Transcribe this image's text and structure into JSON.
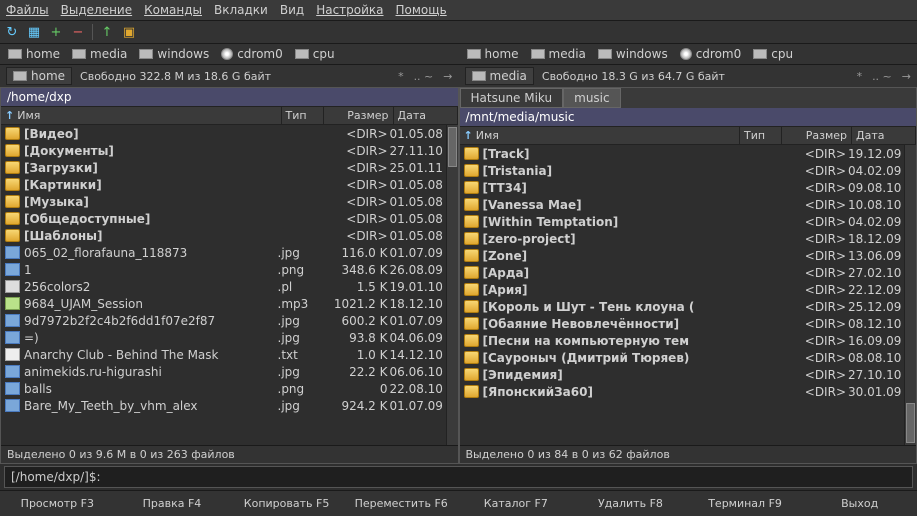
{
  "menu": [
    "Файлы",
    "Выделение",
    "Команды",
    "Вкладки",
    "Вид",
    "Настройка",
    "Помощь"
  ],
  "toolbar_icons": [
    "↻",
    "▦",
    "+",
    "−",
    "",
    "↑",
    "▣"
  ],
  "drives": [
    "home",
    "media",
    "windows",
    "cdrom0",
    "cpu"
  ],
  "left": {
    "current_drive": "home",
    "free": "Свободно 322.8 M из 18.6 G байт",
    "hdr_btns": [
      "*",
      ".. ~",
      "→"
    ],
    "path": "/home/dxp",
    "cols": {
      "name": "Имя",
      "ext": "Тип",
      "size": "Размер",
      "date": "Дата"
    },
    "files": [
      {
        "icon": "folder",
        "name": "[Видео]",
        "ext": "",
        "size": "<DIR>",
        "date": "01.05.08",
        "bold": true
      },
      {
        "icon": "folder",
        "name": "[Документы]",
        "ext": "",
        "size": "<DIR>",
        "date": "27.11.10",
        "bold": true
      },
      {
        "icon": "folder",
        "name": "[Загрузки]",
        "ext": "",
        "size": "<DIR>",
        "date": "25.01.11",
        "bold": true
      },
      {
        "icon": "folder",
        "name": "[Картинки]",
        "ext": "",
        "size": "<DIR>",
        "date": "01.05.08",
        "bold": true
      },
      {
        "icon": "folder",
        "name": "[Музыка]",
        "ext": "",
        "size": "<DIR>",
        "date": "01.05.08",
        "bold": true
      },
      {
        "icon": "folder",
        "name": "[Общедоступные]",
        "ext": "",
        "size": "<DIR>",
        "date": "01.05.08",
        "bold": true
      },
      {
        "icon": "folder",
        "name": "[Шаблоны]",
        "ext": "",
        "size": "<DIR>",
        "date": "01.05.08",
        "bold": true
      },
      {
        "icon": "img",
        "name": "065_02_florafauna_118873",
        "ext": ".jpg",
        "size": "116.0 K",
        "date": "01.07.09"
      },
      {
        "icon": "img",
        "name": "1",
        "ext": ".png",
        "size": "348.6 K",
        "date": "26.08.09"
      },
      {
        "icon": "file",
        "name": "256colors2",
        "ext": ".pl",
        "size": "1.5 K",
        "date": "19.01.10"
      },
      {
        "icon": "audio",
        "name": "9684_UJAM_Session",
        "ext": ".mp3",
        "size": "1021.2 K",
        "date": "18.12.10"
      },
      {
        "icon": "img",
        "name": "9d7972b2f2c4b2f6dd1f07e2f87",
        "ext": ".jpg",
        "size": "600.2 K",
        "date": "01.07.09"
      },
      {
        "icon": "img",
        "name": "=)",
        "ext": ".jpg",
        "size": "93.8 K",
        "date": "04.06.09"
      },
      {
        "icon": "text",
        "name": "Anarchy Club - Behind The Mask",
        "ext": ".txt",
        "size": "1.0 K",
        "date": "14.12.10"
      },
      {
        "icon": "img",
        "name": "animekids.ru-higurashi",
        "ext": ".jpg",
        "size": "22.2 K",
        "date": "06.06.10"
      },
      {
        "icon": "img",
        "name": "balls",
        "ext": ".png",
        "size": "0",
        "date": "22.08.10"
      },
      {
        "icon": "img",
        "name": "Bare_My_Teeth_by_vhm_alex",
        "ext": ".jpg",
        "size": "924.2 K",
        "date": "01.07.09"
      }
    ],
    "status": "Выделено 0 из 9.6 M в 0 из 263 файлов"
  },
  "right": {
    "current_drive": "media",
    "free": "Свободно 18.3 G из 64.7 G байт",
    "hdr_btns": [
      "*",
      ".. ~",
      "→"
    ],
    "tabs": [
      "Hatsune Miku",
      "music"
    ],
    "active_tab": 1,
    "path": "/mnt/media/music",
    "cols": {
      "name": "Имя",
      "ext": "Тип",
      "size": "Размер",
      "date": "Дата"
    },
    "files": [
      {
        "icon": "folder",
        "name": "[Track]",
        "ext": "",
        "size": "<DIR>",
        "date": "19.12.09",
        "bold": true
      },
      {
        "icon": "folder",
        "name": "[Tristania]",
        "ext": "",
        "size": "<DIR>",
        "date": "04.02.09",
        "bold": true
      },
      {
        "icon": "folder",
        "name": "[TT34]",
        "ext": "",
        "size": "<DIR>",
        "date": "09.08.10",
        "bold": true
      },
      {
        "icon": "folder",
        "name": "[Vanessa Mae]",
        "ext": "",
        "size": "<DIR>",
        "date": "10.08.10",
        "bold": true
      },
      {
        "icon": "folder",
        "name": "[Within Temptation]",
        "ext": "",
        "size": "<DIR>",
        "date": "04.02.09",
        "bold": true
      },
      {
        "icon": "folder",
        "name": "[zero-project]",
        "ext": "",
        "size": "<DIR>",
        "date": "18.12.09",
        "bold": true
      },
      {
        "icon": "folder",
        "name": "[Zone]",
        "ext": "",
        "size": "<DIR>",
        "date": "13.06.09",
        "bold": true
      },
      {
        "icon": "folder",
        "name": "[Арда]",
        "ext": "",
        "size": "<DIR>",
        "date": "27.02.10",
        "bold": true
      },
      {
        "icon": "folder",
        "name": "[Ария]",
        "ext": "",
        "size": "<DIR>",
        "date": "22.12.09",
        "bold": true
      },
      {
        "icon": "folder",
        "name": "[Король и Шут - Тень клоуна (",
        "ext": "",
        "size": "<DIR>",
        "date": "25.12.09",
        "bold": true
      },
      {
        "icon": "folder",
        "name": "[Обаяние Невовлечённости]",
        "ext": "",
        "size": "<DIR>",
        "date": "08.12.10",
        "bold": true
      },
      {
        "icon": "folder",
        "name": "[Песни на компьютерную тем",
        "ext": "",
        "size": "<DIR>",
        "date": "16.09.09",
        "bold": true
      },
      {
        "icon": "folder",
        "name": "[Сауроныч (Дмитрий Тюряев)",
        "ext": "",
        "size": "<DIR>",
        "date": "08.08.10",
        "bold": true
      },
      {
        "icon": "folder",
        "name": "[Эпидемия]",
        "ext": "",
        "size": "<DIR>",
        "date": "27.10.10",
        "bold": true
      },
      {
        "icon": "folder",
        "name": "[ЯпонскийЗа60]",
        "ext": "",
        "size": "<DIR>",
        "date": "30.01.09",
        "bold": true
      }
    ],
    "status": "Выделено 0 из 84 в 0 из 62 файлов"
  },
  "prompt": "[/home/dxp/]$:",
  "fnkeys": [
    {
      "label": "Просмотр",
      "key": "F3"
    },
    {
      "label": "Правка",
      "key": "F4"
    },
    {
      "label": "Копировать",
      "key": "F5"
    },
    {
      "label": "Переместить",
      "key": "F6"
    },
    {
      "label": "Каталог",
      "key": "F7"
    },
    {
      "label": "Удалить",
      "key": "F8"
    },
    {
      "label": "Терминал",
      "key": "F9"
    },
    {
      "label": "Выход",
      "key": ""
    }
  ]
}
